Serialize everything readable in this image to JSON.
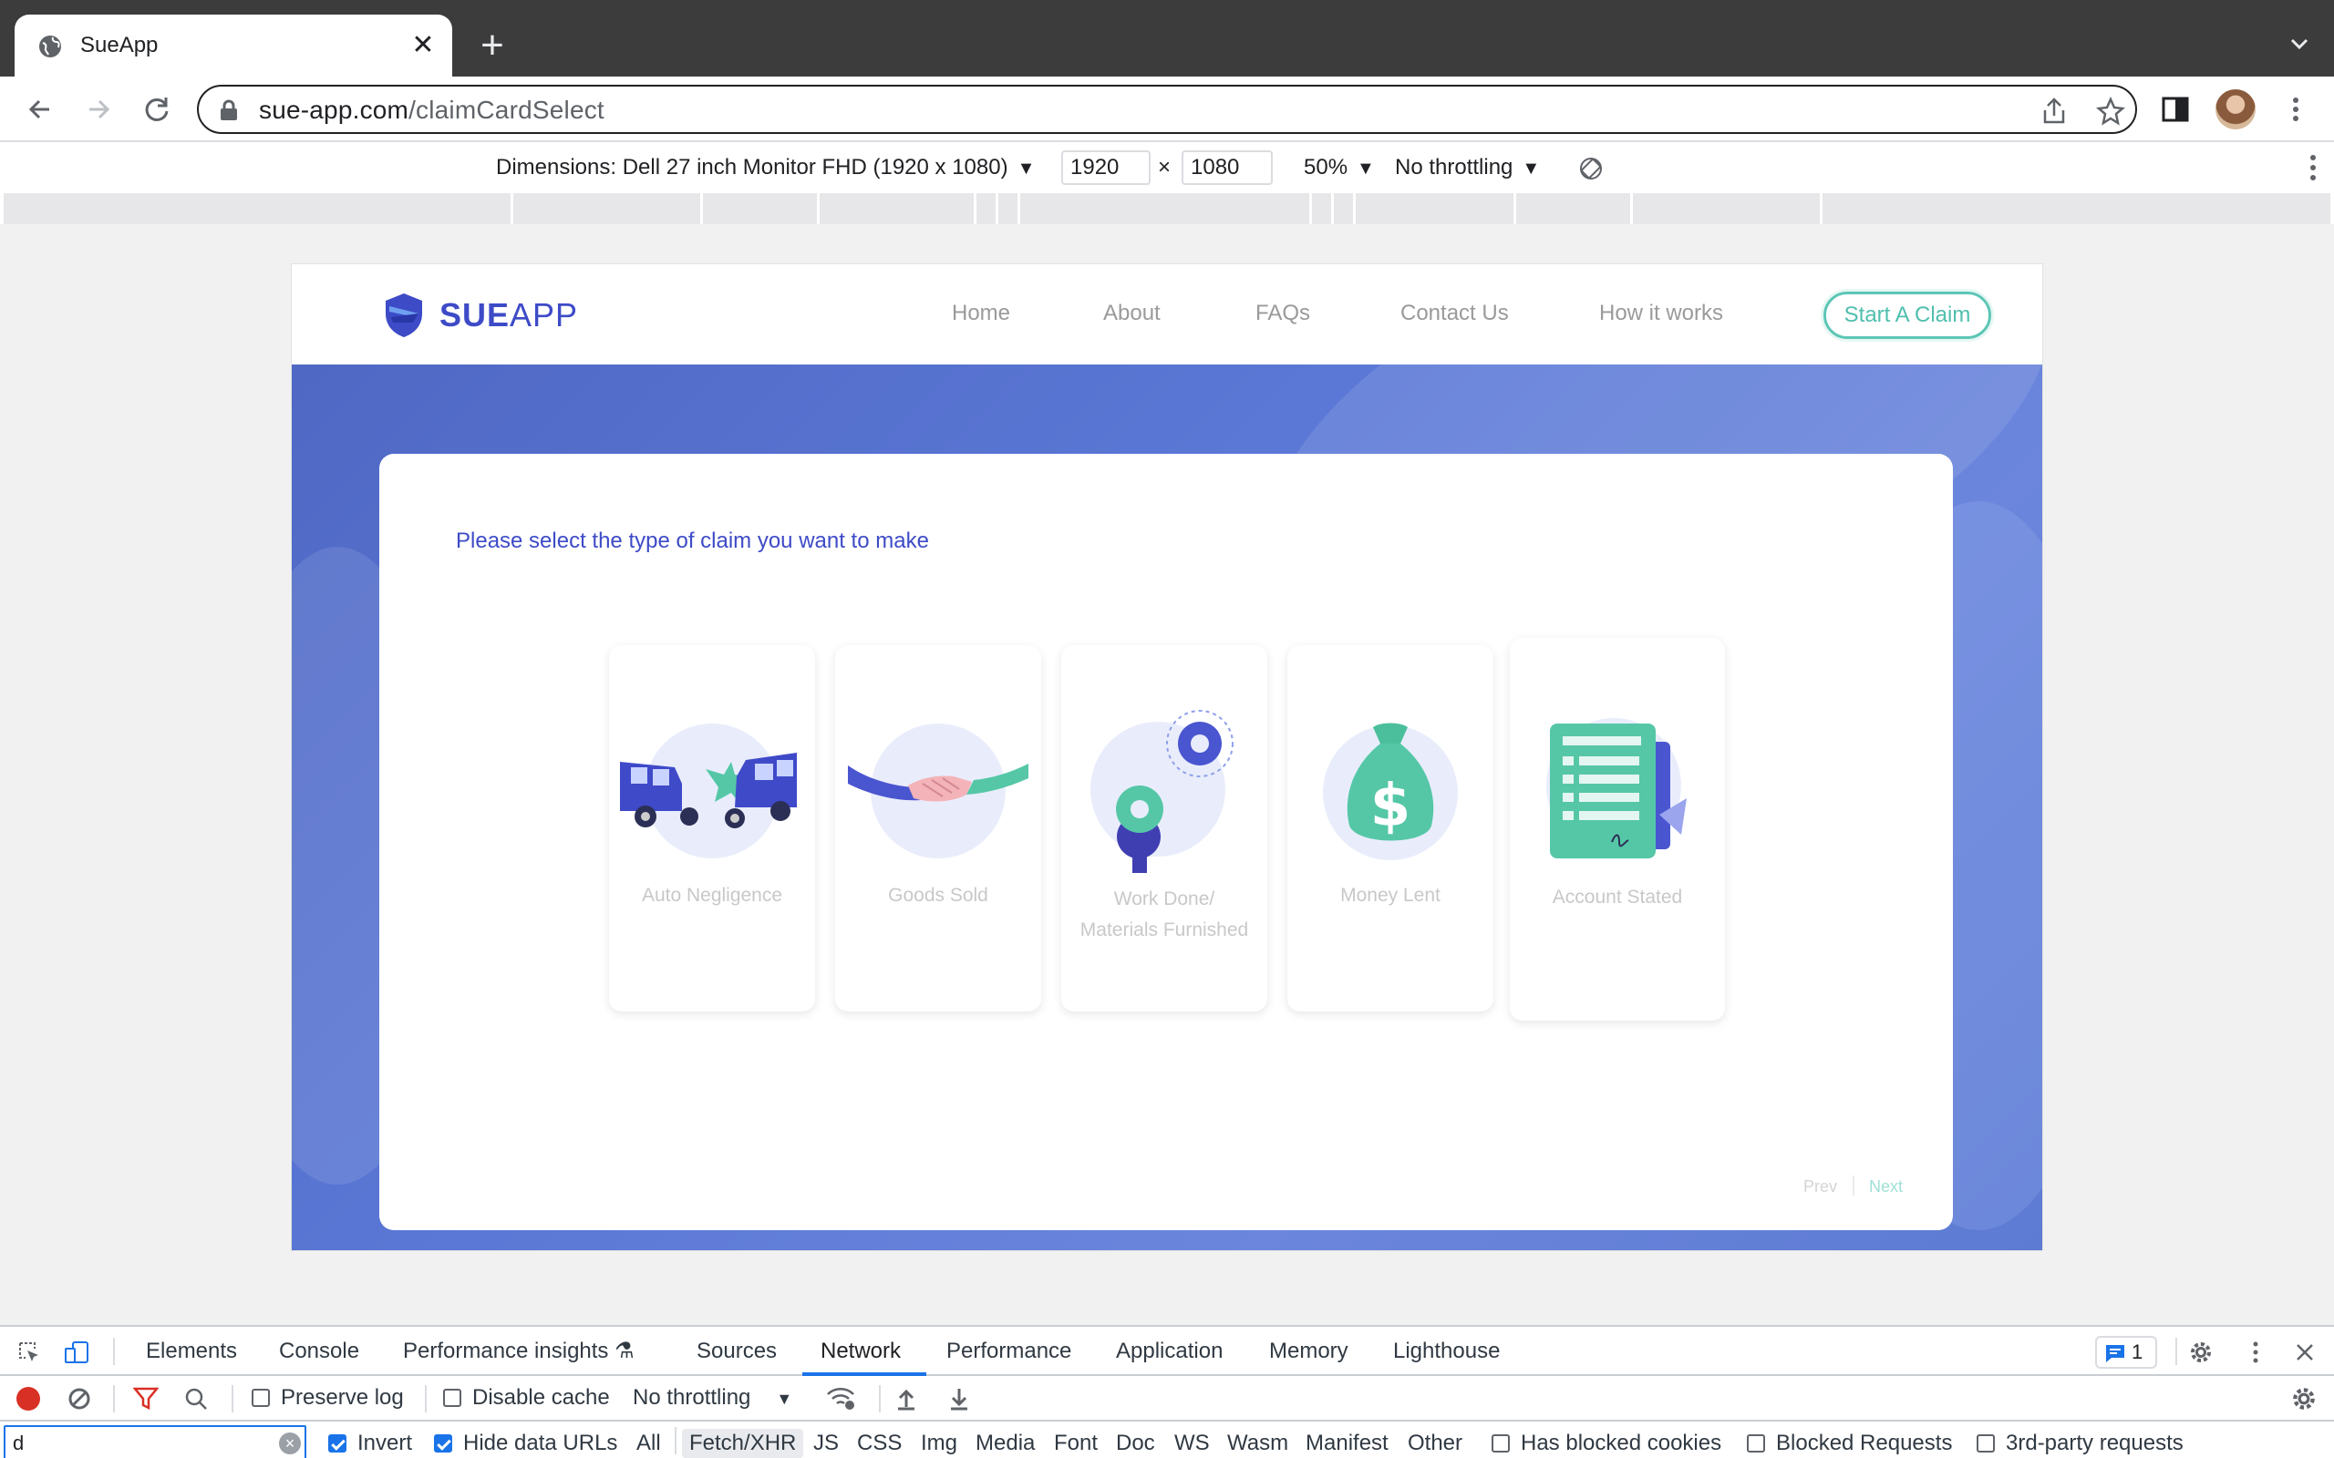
{
  "browser": {
    "tab_title": "SueApp",
    "url_host": "sue-app.com",
    "url_path": "/claimCardSelect"
  },
  "device_toolbar": {
    "dimensions_label": "Dimensions: Dell 27 inch Monitor FHD (1920 x 1080)",
    "width_value": "1920",
    "times": "×",
    "height_value": "1080",
    "zoom": "50%",
    "throttling": "No throttling"
  },
  "site": {
    "brand_bold": "SUE",
    "brand_light": "APP",
    "nav": [
      "Home",
      "About",
      "FAQs",
      "Contact Us",
      "How it works"
    ],
    "cta": "Start A Claim",
    "prompt": "Please select the type of claim you want to make",
    "claims": [
      {
        "line1": "Auto Negligence",
        "line2": ""
      },
      {
        "line1": "Goods Sold",
        "line2": ""
      },
      {
        "line1": "Work Done/",
        "line2": "Materials Furnished"
      },
      {
        "line1": "Money Lent",
        "line2": ""
      },
      {
        "line1": "Account Stated",
        "line2": ""
      }
    ],
    "pager": {
      "prev": "Prev",
      "next": "Next"
    }
  },
  "devtools": {
    "tabs": [
      "Elements",
      "Console",
      "Performance insights",
      "Sources",
      "Network",
      "Performance",
      "Application",
      "Memory",
      "Lighthouse"
    ],
    "active_tab": "Network",
    "message_count": "1",
    "preserve_log": "Preserve log",
    "disable_cache": "Disable cache",
    "throttling": "No throttling",
    "filter_value": "d",
    "invert": "Invert",
    "hide_data_urls": "Hide data URLs",
    "type_filters": [
      "All",
      "Fetch/XHR",
      "JS",
      "CSS",
      "Img",
      "Media",
      "Font",
      "Doc",
      "WS",
      "Wasm",
      "Manifest",
      "Other"
    ],
    "active_type_filter": "Fetch/XHR",
    "has_blocked_cookies": "Has blocked cookies",
    "blocked_requests": "Blocked Requests",
    "third_party": "3rd-party requests"
  },
  "colors": {
    "brand_blue": "#3d4bc7",
    "cta_teal": "#4fbfae",
    "hero_blue": "#5b78d6",
    "devtools_accent": "#1a73e8"
  }
}
